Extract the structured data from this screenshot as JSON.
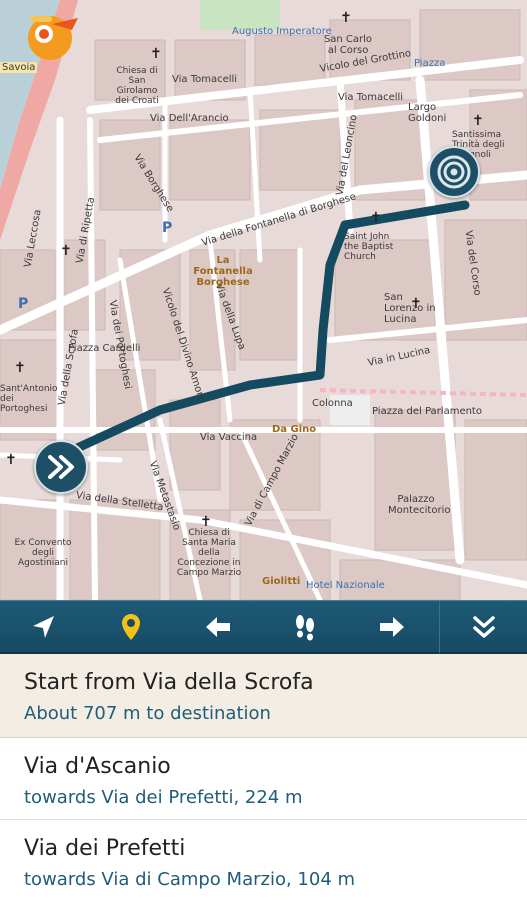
{
  "map": {
    "streets": [
      {
        "name": "Via Tomacelli"
      },
      {
        "name": "Via Dell'Arancio"
      },
      {
        "name": "Via Tomacelli"
      },
      {
        "name": "Vicolo del Grottino"
      },
      {
        "name": "Via del Leoncino"
      },
      {
        "name": "Via Borghese"
      },
      {
        "name": "Via della Fontanella di Borghese"
      },
      {
        "name": "Via di Ripetta"
      },
      {
        "name": "Via Leccosa"
      },
      {
        "name": "Via del Corso"
      },
      {
        "name": "Via della Lupa"
      },
      {
        "name": "Vicolo del Divino Amore"
      },
      {
        "name": "Via dei Portoghesi"
      },
      {
        "name": "Via in Lucina"
      },
      {
        "name": "Via della Scrofa"
      },
      {
        "name": "Via Vaccina"
      },
      {
        "name": "Via della Stelletta"
      },
      {
        "name": "Via Metastasio"
      },
      {
        "name": "Via di Campo Marzio"
      },
      {
        "name": "Piazza Cardelli"
      },
      {
        "name": "Piazza del Parlamento"
      },
      {
        "name": "Colonna"
      }
    ],
    "pois": [
      {
        "name": "Augusto Imperatore"
      },
      {
        "name": "San Carlo al Corso"
      },
      {
        "name": "Chiesa di San Girolamo dei Croati"
      },
      {
        "name": "Largo Goldoni"
      },
      {
        "name": "Santissima Trinità degli Spagnoli"
      },
      {
        "name": "La Fontanella Borghese"
      },
      {
        "name": "Saint John the Baptist Church"
      },
      {
        "name": "San Lorenzo in Lucina"
      },
      {
        "name": "Da Gino"
      },
      {
        "name": "Palazzo Montecitorio"
      },
      {
        "name": "Chiesa di Santa Maria della Concezione in Campo Marzio"
      },
      {
        "name": "Giolitti"
      },
      {
        "name": "Hotel Nazionale"
      },
      {
        "name": "Ex Convento degli Agostiniani"
      },
      {
        "name": "Sant'Antonio dei Portoghesi"
      },
      {
        "name": "Piazza"
      },
      {
        "name": "Savoia"
      }
    ],
    "icons": {
      "start": "fast-forward-icon",
      "end": "target-icon",
      "logo": "app-logo"
    },
    "route_color": "#154b61"
  },
  "toolbar": {
    "buttons": [
      {
        "icon": "navigate-arrow-icon"
      },
      {
        "icon": "location-pin-icon"
      },
      {
        "icon": "arrow-left-icon"
      },
      {
        "icon": "footsteps-icon"
      },
      {
        "icon": "arrow-right-icon"
      },
      {
        "icon": "double-chevron-down-icon"
      }
    ],
    "accent": "#f2c21b"
  },
  "directions": {
    "header": {
      "title": "Start from Via della Scrofa",
      "subtitle": "About 707 m to destination"
    },
    "steps": [
      {
        "street": "Via d'Ascanio",
        "toward": "towards Via dei Prefetti, 224 m"
      },
      {
        "street": "Via dei Prefetti",
        "toward": "towards Via di Campo Marzio, 104 m"
      }
    ]
  }
}
